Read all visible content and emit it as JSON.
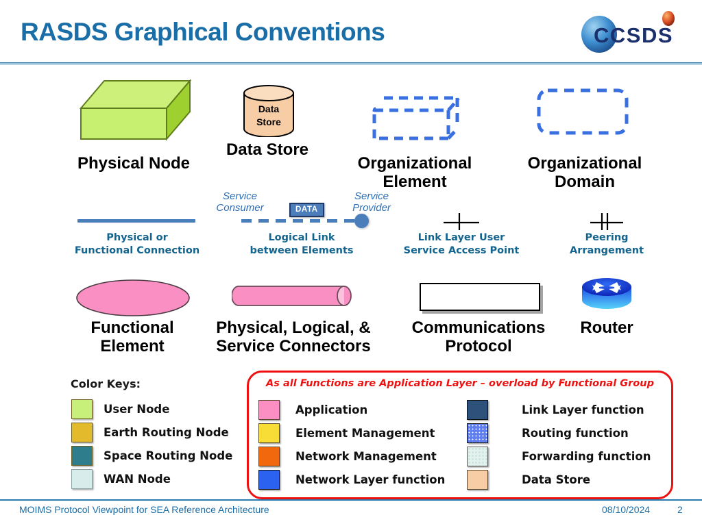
{
  "header": {
    "title": "RASDS Graphical Conventions",
    "logo_text": "CCSDS",
    "logo_name": "ccsds-logo"
  },
  "symbols": {
    "physical_node": {
      "label": "Physical Node",
      "fill": "#bdea5a",
      "top_fill": "#cdf07a",
      "side_fill": "#9ed02f",
      "edge": "#5f7d1c"
    },
    "data_store": {
      "label": "Data Store",
      "inner_line1": "Data",
      "inner_line2": "Store",
      "fill": "#f7cda6",
      "edge": "#000000"
    },
    "organizational_element": {
      "label_line1": "Organizational",
      "label_line2": "Element",
      "stroke": "#3a6fe0"
    },
    "organizational_domain": {
      "label_line1": "Organizational",
      "label_line2": "Domain",
      "stroke": "#3a6fe0"
    },
    "functional_element": {
      "label_line1": "Functional",
      "label_line2": "Element",
      "fill": "#f98fc2",
      "edge": "#6b4a5a"
    },
    "service_connectors": {
      "label_line1": "Physical, Logical, &",
      "label_line2": "Service Connectors",
      "fill": "#f98fc2",
      "cap_fill": "#fcc2dd",
      "edge": "#6b4a5a"
    },
    "communications_protocol": {
      "label_line1": "Communications",
      "label_line2": "Protocol",
      "fill": "#ffffff",
      "edge": "#000000"
    },
    "router": {
      "label": "Router",
      "fill_top": "#1437e0",
      "fill_bottom": "#43c8f5"
    }
  },
  "connectors": {
    "physical_connection": {
      "caption_line1": "Physical or",
      "caption_line2": "Functional Connection",
      "color": "#4a7ebb"
    },
    "logical_link": {
      "caption_line1": "Logical Link",
      "caption_line2": "between Elements",
      "consumer_line1": "Service",
      "consumer_line2": "Consumer",
      "provider_line1": "Service",
      "provider_line2": "Provider",
      "data_badge": "DATA",
      "color": "#4a7ebb"
    },
    "service_access_point": {
      "caption_line1": "Link Layer User",
      "caption_line2": "Service Access Point"
    },
    "peering": {
      "caption_line1": "Peering",
      "caption_line2": "Arrangement"
    }
  },
  "color_keys": {
    "title": "Color Keys:",
    "items": [
      {
        "label": "User Node",
        "color": "#c6f07a"
      },
      {
        "label": "Earth Routing Node",
        "color": "#e3ba2c"
      },
      {
        "label": "Space Routing Node",
        "color": "#2e7d8c"
      },
      {
        "label": "WAN Node",
        "color": "#d8eceb"
      }
    ]
  },
  "functional_groups": {
    "heading": "As all Functions are Application Layer – overload by Functional Group",
    "left_items": [
      {
        "label": "Application",
        "color": "#fb8fc4"
      },
      {
        "label": "Element Management",
        "color": "#f7dd36"
      },
      {
        "label": "Network Management",
        "color": "#f2690d"
      },
      {
        "label": "Network Layer function",
        "color": "#2b63f0"
      }
    ],
    "right_items": [
      {
        "label": "Link Layer function",
        "color": "#2e517c"
      },
      {
        "label": "Routing function",
        "color": "#5f7ff0"
      },
      {
        "label": "Forwarding function",
        "color": "#e3f2ee"
      },
      {
        "label": "Data Store",
        "color": "#f7cda6"
      }
    ]
  },
  "footer": {
    "left": "MOIMS Protocol Viewpoint for SEA Reference Architecture",
    "date": "08/10/2024",
    "page": "2"
  }
}
